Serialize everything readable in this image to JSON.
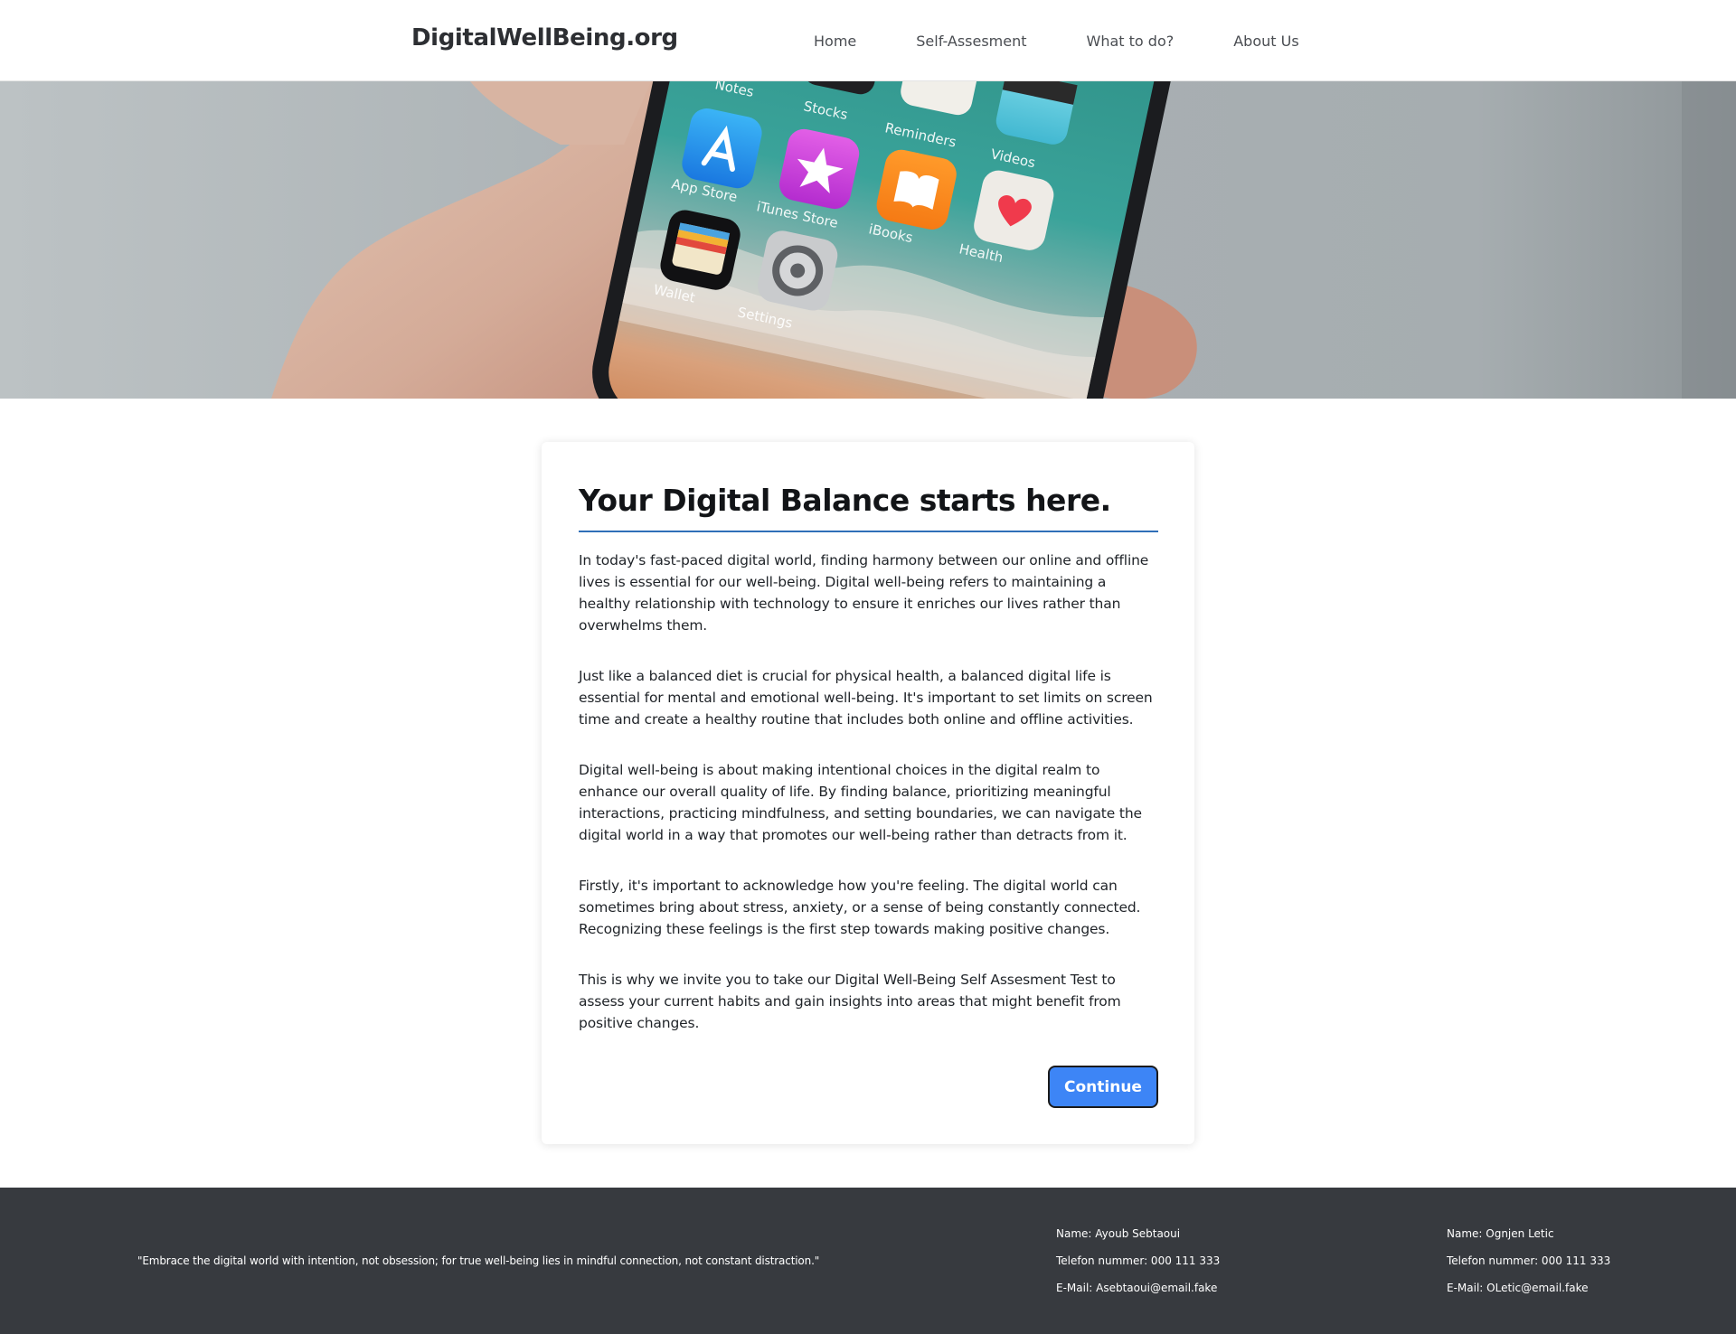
{
  "header": {
    "brand": "DigitalWellBeing.org",
    "nav": [
      {
        "label": "Home"
      },
      {
        "label": "Self-Assesment"
      },
      {
        "label": "What to do?"
      },
      {
        "label": "About Us"
      }
    ]
  },
  "hero": {
    "image_semantic": "hand-holding-phone-photo",
    "app_labels": [
      "Notes",
      "Stocks",
      "Reminders",
      "Videos",
      "App Store",
      "iTunes Store",
      "iBooks",
      "Health",
      "Wallet",
      "Settings"
    ]
  },
  "main": {
    "title": "Your Digital Balance starts here.",
    "paragraphs": [
      "In today's fast-paced digital world, finding harmony between our online and offline lives is essential for our well-being. Digital well-being refers to maintaining a healthy relationship with technology to ensure it enriches our lives rather than overwhelms them.",
      "Just like a balanced diet is crucial for physical health, a balanced digital life is essential for mental and emotional well-being. It's important to set limits on screen time and create a healthy routine that includes both online and offline activities.",
      "Digital well-being is about making intentional choices in the digital realm to enhance our overall quality of life. By finding balance, prioritizing meaningful interactions, practicing mindfulness, and setting boundaries, we can navigate the digital world in a way that promotes our well-being rather than detracts from it.",
      "Firstly, it's important to acknowledge how you're feeling. The digital world can sometimes bring about stress, anxiety, or a sense of being constantly connected. Recognizing these feelings is the first step towards making positive changes.",
      "This is why we invite you to take our Digital Well-Being Self Assesment Test to assess your current habits and gain insights into areas that might benefit from positive changes."
    ],
    "continue_label": "Continue"
  },
  "footer": {
    "quote": "\"Embrace the digital world with intention, not obsession; for true well-being lies in mindful connection, not constant distraction.\"",
    "contacts": [
      {
        "name": "Name: Ayoub Sebtaoui",
        "phone": "Telefon nummer: 000 111 333",
        "email": "E-Mail: Asebtaoui@email.fake"
      },
      {
        "name": "Name: Ognjen Letic",
        "phone": "Telefon nummer: 000 111 333",
        "email": "E-Mail: OLetic@email.fake"
      }
    ]
  },
  "colors": {
    "accent": "#3d85f6",
    "underline": "#2f6fb8",
    "footer_bg": "#373a3f"
  }
}
